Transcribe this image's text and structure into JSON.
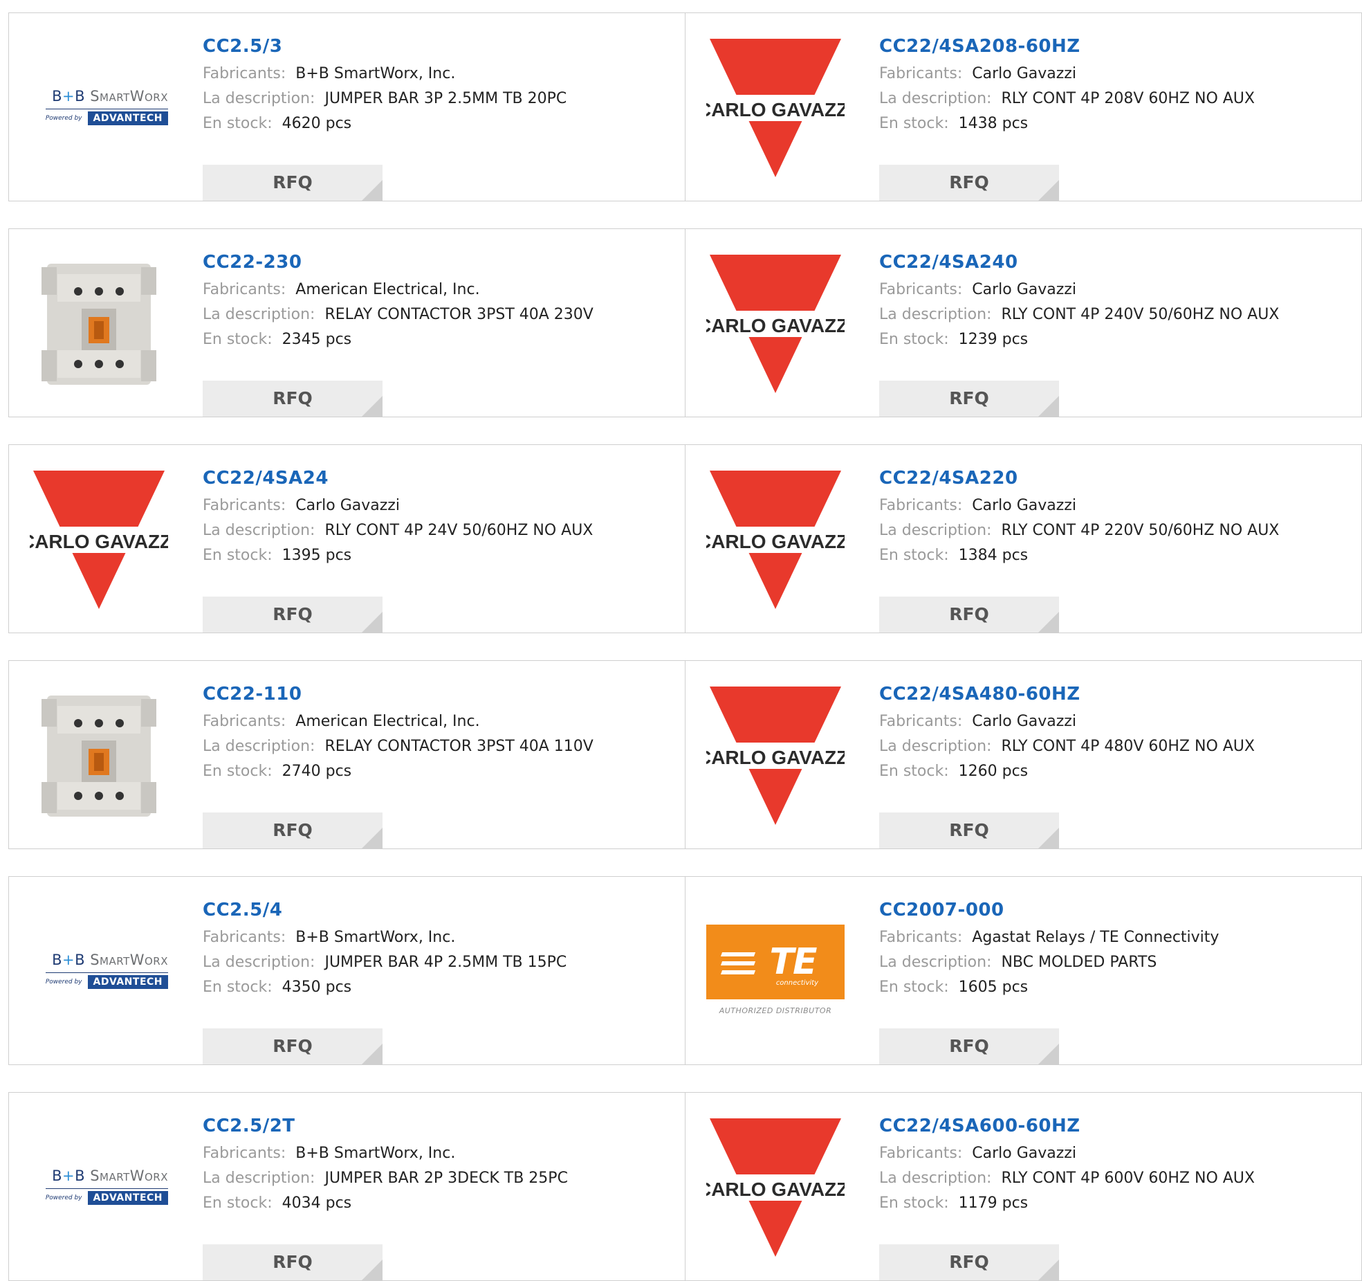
{
  "labels": {
    "manufacturer": "Fabricants:",
    "description": "La description:",
    "stock": "En stock:",
    "rfq": "RFQ"
  },
  "colors": {
    "link": "#1a66b8",
    "carlo_red": "#e8392c",
    "te_orange": "#f28c1a",
    "advantech_blue": "#1f4e96"
  },
  "logos": {
    "bb": {
      "top_b1": "B",
      "top_plus": "+",
      "top_b2": "B",
      "top_rest": "SmartWorx",
      "powered": "Powered by",
      "advantech": "ADVANTECH"
    },
    "carlo": {
      "text": "CARLO GAVAZZI"
    },
    "te": {
      "text": "TE",
      "sub": "connectivity",
      "authorized": "AUTHORIZED DISTRIBUTOR"
    }
  },
  "products": [
    {
      "part": "CC2.5/3",
      "logo": "bb-logo",
      "manufacturer": "B+B SmartWorx, Inc.",
      "description": "JUMPER BAR 3P 2.5MM TB 20PC",
      "stock": "4620 pcs"
    },
    {
      "part": "CC22/4SA208-60HZ",
      "logo": "carlo-gavazzi-logo",
      "manufacturer": "Carlo Gavazzi",
      "description": "RLY CONT 4P 208V 60HZ NO AUX",
      "stock": "1438 pcs"
    },
    {
      "part": "CC22-230",
      "logo": "contactor-image",
      "manufacturer": "American Electrical, Inc.",
      "description": "RELAY CONTACTOR 3PST 40A 230V",
      "stock": "2345 pcs"
    },
    {
      "part": "CC22/4SA240",
      "logo": "carlo-gavazzi-logo",
      "manufacturer": "Carlo Gavazzi",
      "description": "RLY CONT 4P 240V 50/60HZ NO AUX",
      "stock": "1239 pcs"
    },
    {
      "part": "CC22/4SA24",
      "logo": "carlo-gavazzi-logo",
      "manufacturer": "Carlo Gavazzi",
      "description": "RLY CONT 4P 24V 50/60HZ NO AUX",
      "stock": "1395 pcs"
    },
    {
      "part": "CC22/4SA220",
      "logo": "carlo-gavazzi-logo",
      "manufacturer": "Carlo Gavazzi",
      "description": "RLY CONT 4P 220V 50/60HZ NO AUX",
      "stock": "1384 pcs"
    },
    {
      "part": "CC22-110",
      "logo": "contactor-image",
      "manufacturer": "American Electrical, Inc.",
      "description": "RELAY CONTACTOR 3PST 40A 110V",
      "stock": "2740 pcs"
    },
    {
      "part": "CC22/4SA480-60HZ",
      "logo": "carlo-gavazzi-logo",
      "manufacturer": "Carlo Gavazzi",
      "description": "RLY CONT 4P 480V 60HZ NO AUX",
      "stock": "1260 pcs"
    },
    {
      "part": "CC2.5/4",
      "logo": "bb-logo",
      "manufacturer": "B+B SmartWorx, Inc.",
      "description": "JUMPER BAR 4P 2.5MM TB 15PC",
      "stock": "4350 pcs"
    },
    {
      "part": "CC2007-000",
      "logo": "te-logo",
      "manufacturer": "Agastat Relays / TE Connectivity",
      "description": "NBC MOLDED PARTS",
      "stock": "1605 pcs"
    },
    {
      "part": "CC2.5/2T",
      "logo": "bb-logo",
      "manufacturer": "B+B SmartWorx, Inc.",
      "description": "JUMPER BAR 2P 3DECK TB 25PC",
      "stock": "4034 pcs"
    },
    {
      "part": "CC22/4SA600-60HZ",
      "logo": "carlo-gavazzi-logo",
      "manufacturer": "Carlo Gavazzi",
      "description": "RLY CONT 4P 600V 60HZ NO AUX",
      "stock": "1179 pcs"
    }
  ]
}
